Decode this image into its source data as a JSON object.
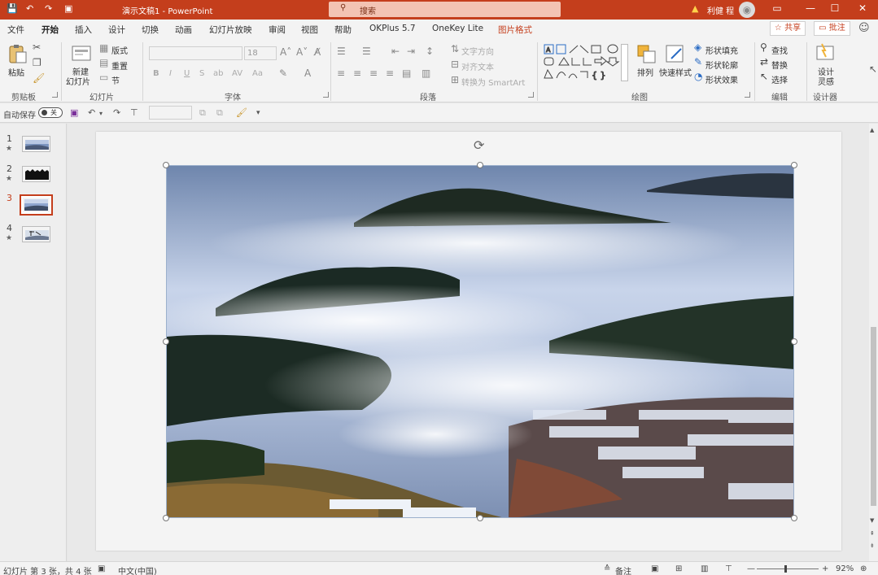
{
  "titlebar": {
    "doc_title": "演示文稿1  -  PowerPoint",
    "search_placeholder": "搜索",
    "user_name": "利健 程",
    "minimize": "—",
    "maximize": "☐",
    "close": "✕",
    "ribbon_display": "▭"
  },
  "tabs": [
    "文件",
    "开始",
    "插入",
    "设计",
    "切换",
    "动画",
    "幻灯片放映",
    "审阅",
    "视图",
    "帮助",
    "OKPlus 5.7",
    "OneKey Lite",
    "图片格式"
  ],
  "tabs_right": {
    "share": "☆ 共享",
    "comments": "▭ 批注"
  },
  "ribbon": {
    "clipboard": {
      "paste": "粘贴",
      "label": "剪贴板"
    },
    "slides": {
      "new_slide_1": "新建",
      "new_slide_2": "幻灯片",
      "layout": "版式",
      "reset": "重置",
      "section": "节",
      "label": "幻灯片"
    },
    "font": {
      "font_size": "18",
      "bold": "B",
      "italic": "I",
      "underline": "U",
      "strike": "S",
      "shadow": "ab",
      "spacing": "AV",
      "case": "Aa",
      "label": "字体"
    },
    "paragraph": {
      "text_direction": "文字方向",
      "align_text": "对齐文本",
      "smartart": "转换为 SmartArt",
      "label": "段落"
    },
    "drawing": {
      "arrange": "排列",
      "quick_styles": "快速样式",
      "fill": "形状填充",
      "outline": "形状轮廓",
      "effects": "形状效果",
      "label": "绘图"
    },
    "editing": {
      "find": "查找",
      "replace": "替换",
      "select": "选择",
      "label": "编辑"
    },
    "designer": {
      "line1": "设计",
      "line2": "灵感",
      "label": "设计器"
    }
  },
  "qat": {
    "autosave": "自动保存",
    "autosave_state": "关"
  },
  "thumbnails": [
    {
      "num": "1",
      "star": "★"
    },
    {
      "num": "2",
      "star": "★"
    },
    {
      "num": "3",
      "star": ""
    },
    {
      "num": "4",
      "star": "★"
    }
  ],
  "status": {
    "slide_info": "幻灯片 第 3 张，共 4 张",
    "language": "中文(中国)",
    "notes": "备注",
    "zoom": "92%",
    "zoom_minus": "—",
    "zoom_plus": "+"
  },
  "colors": {
    "accent": "#c43e1c",
    "ribbon_bg": "#f3f3f3"
  }
}
